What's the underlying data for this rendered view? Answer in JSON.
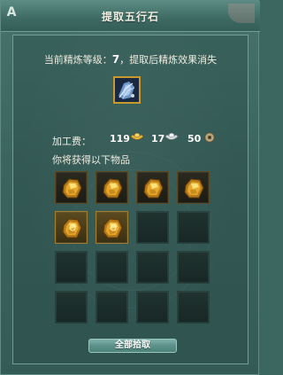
{
  "window": {
    "title": "提取五行石",
    "corner_glyph": "A"
  },
  "refine_info": {
    "prefix": "当前精炼等级：",
    "level": "7",
    "suffix": "，提取后精炼效果消失"
  },
  "item": {
    "icon": "blue-crystal-item-icon"
  },
  "fee": {
    "label": "加工费：",
    "gold": "119",
    "silver": "17",
    "copper": "50",
    "gold_icon": "gold-ingot-icon",
    "silver_icon": "silver-ingot-icon",
    "copper_icon": "copper-coin-icon"
  },
  "gain_label": "你将获得以下物品",
  "grid": {
    "rows": 4,
    "cols": 4,
    "items": [
      {
        "icon": "gold-ore-icon",
        "style": "plain"
      },
      {
        "icon": "gold-ore-icon",
        "style": "plain"
      },
      {
        "icon": "gold-ore-icon",
        "style": "plain"
      },
      {
        "icon": "gold-ore-icon",
        "style": "plain"
      },
      {
        "icon": "gold-ore-icon",
        "style": "highlight"
      },
      {
        "icon": "gold-ore-icon",
        "style": "highlight"
      }
    ]
  },
  "button": {
    "label": "全部拾取"
  },
  "colors": {
    "background": "#3c6660",
    "gold": "#e8b43a",
    "slot_border": "#26423e"
  }
}
